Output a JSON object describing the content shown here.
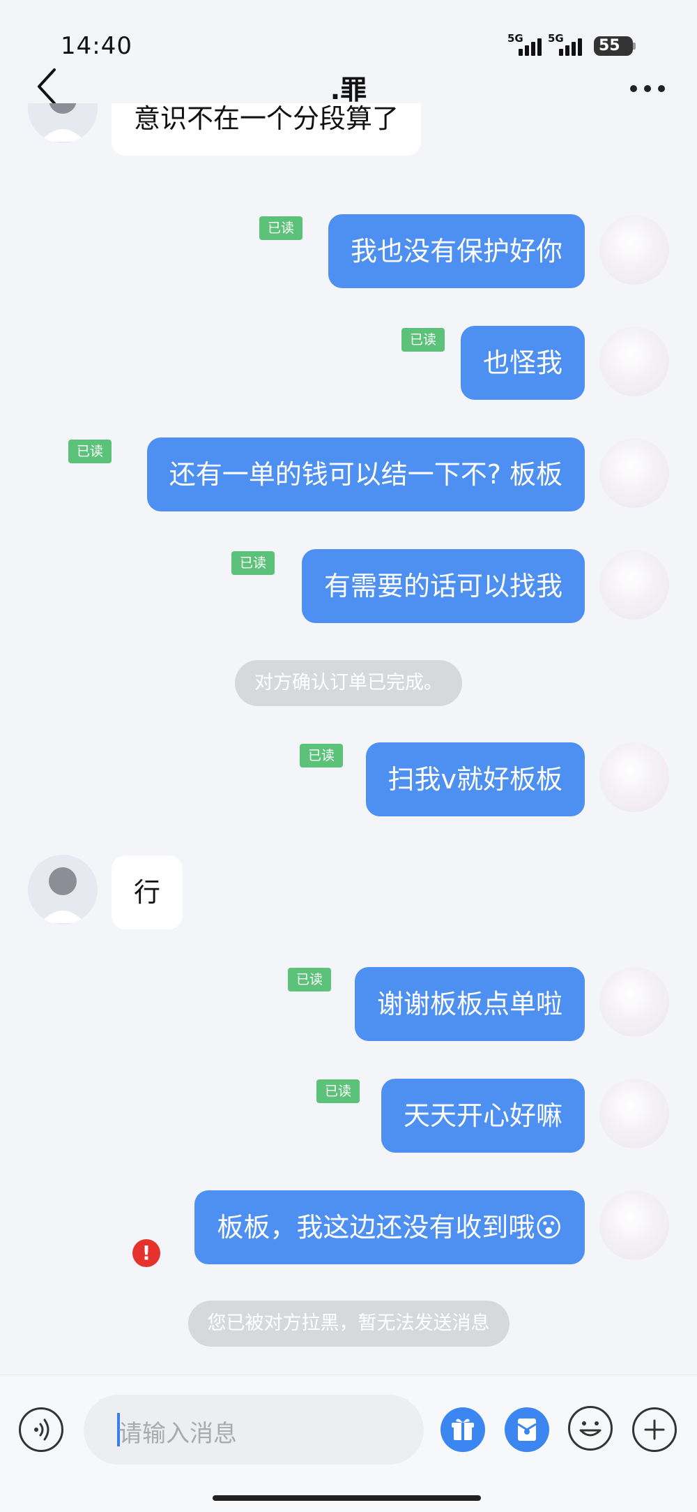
{
  "status": {
    "time": "14:40",
    "signal_1": "5G",
    "signal_2": "5G",
    "battery": "55"
  },
  "nav": {
    "title": ".罪"
  },
  "conversation": {
    "read_label": "已读",
    "messages": [
      {
        "from": "other",
        "text": "意识不在一个分段算了"
      },
      {
        "from": "me",
        "text": "我也没有保护好你",
        "read": true
      },
      {
        "from": "me",
        "text": "也怪我",
        "read": true
      },
      {
        "from": "me",
        "text": "还有一单的钱可以结一下不? 板板",
        "read": true
      },
      {
        "from": "me",
        "text": "有需要的话可以找我",
        "read": true
      },
      {
        "from": "system",
        "text": "对方确认订单已完成。"
      },
      {
        "from": "me",
        "text": "扫我v就好板板",
        "read": true
      },
      {
        "from": "other",
        "text": "行"
      },
      {
        "from": "me",
        "text": "谢谢板板点单啦",
        "read": true
      },
      {
        "from": "me",
        "text": "天天开心好嘛",
        "read": true
      },
      {
        "from": "me",
        "text": "板板，我这边还没有收到哦😮",
        "read": false,
        "failed": true
      },
      {
        "from": "system",
        "text": "您已被对方拉黑，暂无法发送消息"
      }
    ]
  },
  "input_bar": {
    "placeholder": "请输入消息"
  },
  "icons": [
    "back-icon",
    "more-icon",
    "voice-icon",
    "gift-icon",
    "red-packet-icon",
    "emoji-icon",
    "plus-icon",
    "error-icon"
  ],
  "colors": {
    "bubble_me": "#4e8ff2",
    "read_badge": "#5cc279",
    "error": "#e5322d",
    "background": "#f3f5f9"
  }
}
